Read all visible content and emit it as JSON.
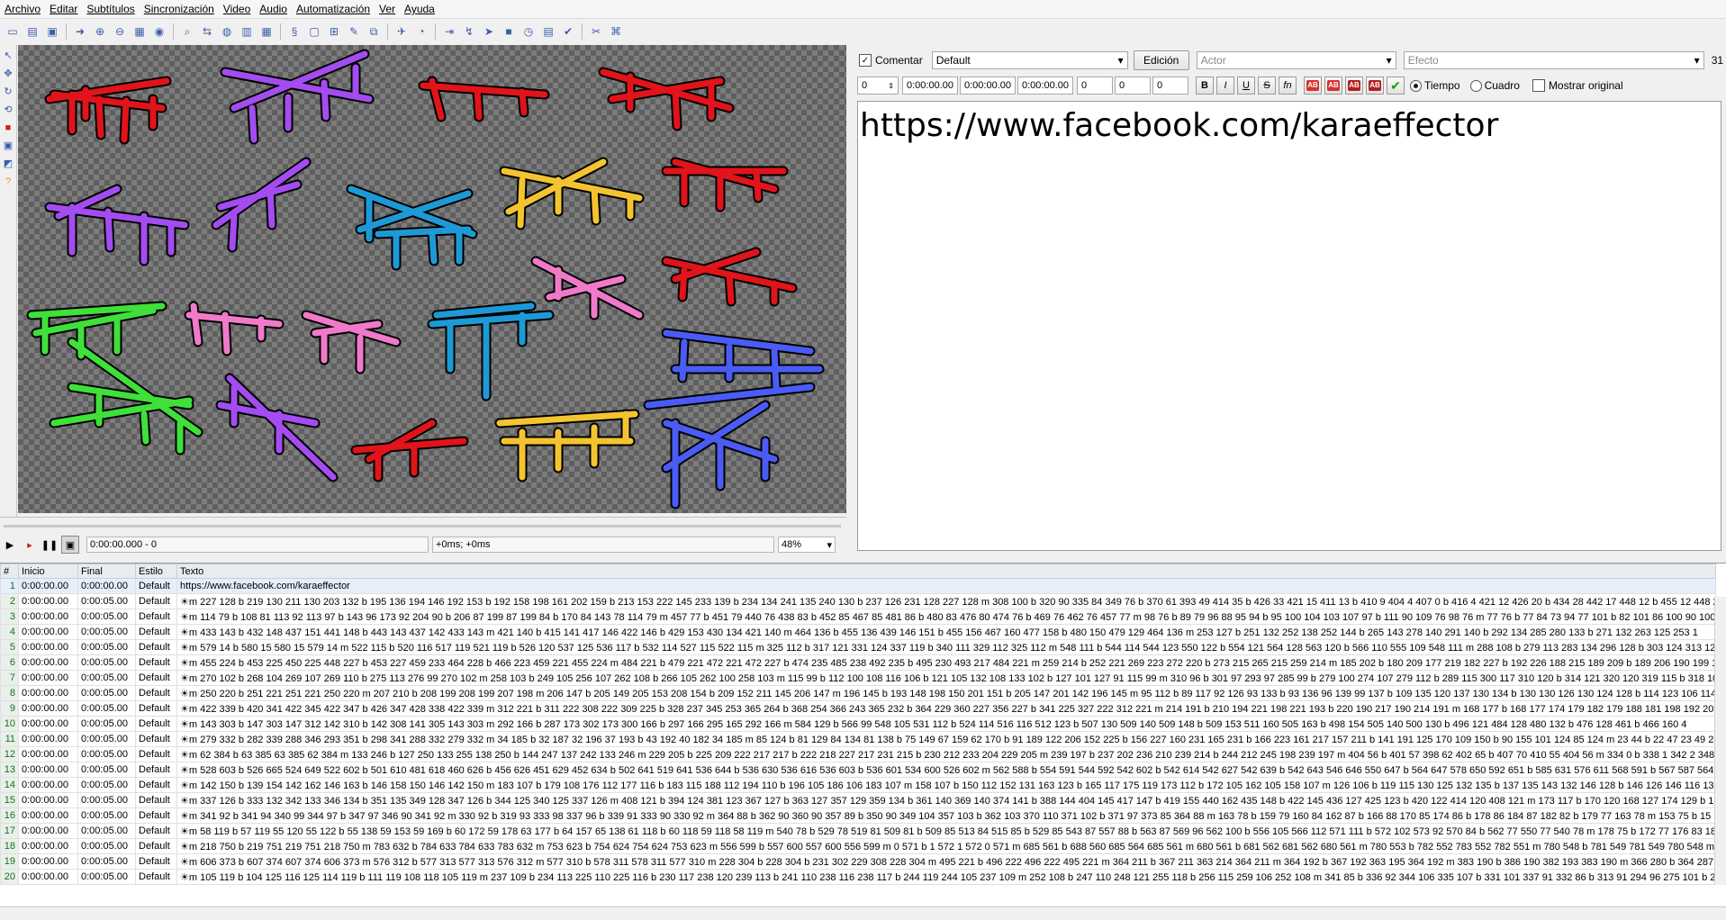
{
  "menu": [
    "Archivo",
    "Editar",
    "Subtítulos",
    "Sincronización",
    "Video",
    "Audio",
    "Automatización",
    "Ver",
    "Ayuda"
  ],
  "video": {
    "time_display": "0:00:00.000 - 0",
    "offset_display": "+0ms; +0ms",
    "zoom": "48%"
  },
  "editor": {
    "comment_label": "Comentar",
    "style_value": "Default",
    "edit_button": "Edición",
    "actor_placeholder": "Actor",
    "effect_placeholder": "Efecto",
    "char_count": "31",
    "layer": "0",
    "start_time": "0:00:00.00",
    "end_time": "0:00:00.00",
    "duration": "0:00:00.00",
    "margin_l": "0",
    "margin_r": "0",
    "margin_v": "0",
    "bold": "B",
    "italic": "I",
    "underline": "U",
    "strike": "S",
    "font": "fn",
    "color_label": "AB",
    "time_radio": "Tiempo",
    "frame_radio": "Cuadro",
    "show_original": "Mostrar original",
    "text": "https://www.facebook.com/karaeffector"
  },
  "grid": {
    "headers": [
      "#",
      "Inicio",
      "Final",
      "Estilo",
      "Texto"
    ],
    "rows": [
      {
        "n": "1",
        "start": "0:00:00.00",
        "end": "0:00:00.00",
        "style": "Default",
        "text": "https://www.facebook.com/karaeffector"
      },
      {
        "n": "2",
        "start": "0:00:00.00",
        "end": "0:00:05.00",
        "style": "Default",
        "text": "☀m 227 128 b 219 130 211 130 203 132 b 195 136 194 146 192 153 b 192 158 198 161 202 159 b 213 153 222 145 233 139 b 234 134 241 135 240 130 b 237 126 231 128 227 128 m 308 100 b 320 90 335 84 349 76 b 370 61 393 49 414 35 b 426 33 421 15 411 13 b 410 9 404 4 407 0 b 416 4 421 12 426 20 b 434 28 442 17 448 12 b 455 12 448 20 45"
      },
      {
        "n": "3",
        "start": "0:00:00.00",
        "end": "0:00:05.00",
        "style": "Default",
        "text": "☀m 114 79 b 108 81 113 92 113 97 b 143 96 173 92 204 90 b 206 87 199 87 199 84 b 170 84 143 78 114 79 m 457 77 b 451 79 440 76 438 83 b 452 85 467 85 481 86 b 480 83 476 80 474 76 b 469 76 462 76 457 77 m 98 76 b 89 79 96 88 95 94 b 95 100 104 103 107 97 b 111 90 109 76 98 76 m 77 76 b 77 84 73 94 77 101 b 82 101 86 100 90 100 b 90"
      },
      {
        "n": "4",
        "start": "0:00:00.00",
        "end": "0:00:05.00",
        "style": "Default",
        "text": "☀m 433 143 b 432 148 437 151 441 148 b 443 143 437 142 433 143 m 421 140 b 415 141 417 146 422 146 b 429 153 430 134 421 140 m 464 136 b 455 136 439 146 151 b 455 156 467 160 477 158 b 480 150 479 129 464 136 m 253 127 b 251 132 252 138 252 144 b 265 143 278 140 291 140 b 292 134 285 280 133 b 271 132 263 125 253 1"
      },
      {
        "n": "5",
        "start": "0:00:00.00",
        "end": "0:00:05.00",
        "style": "Default",
        "text": "☀m 579 14 b 580 15 580 15 579 14 m 522 115 b 520 116 517 119 521 119 b 526 120 537 125 536 117 b 532 114 527 115 522 115 m 325 112 b 317 121 331 124 337 119 b 340 111 329 112 325 112 m 548 111 b 544 114 544 123 550 122 b 554 121 564 128 563 120 b 566 110 555 109 548 111 m 288 108 b 279 113 283 134 296 128 b 303 124 313 126 3"
      },
      {
        "n": "6",
        "start": "0:00:00.00",
        "end": "0:00:05.00",
        "style": "Default",
        "text": "☀m 455 224 b 453 225 450 225 448 227 b 453 227 459 233 464 228 b 466 223 459 221 455 224 m 484 221 b 479 221 472 221 472 227 b 474 235 485 238 492 235 b 495 230 493 217 484 221 m 259 214 b 252 221 269 223 272 220 b 273 215 265 215 259 214 m 185 202 b 180 209 177 219 182 227 b 192 226 188 215 189 209 b 189 206 190 199 185 20"
      },
      {
        "n": "7",
        "start": "0:00:00.00",
        "end": "0:00:05.00",
        "style": "Default",
        "text": "☀m 270 102 b 268 104 269 107 269 110 b 275 113 276 99 270 102 m 258 103 b 249 105 256 107 262 108 b 266 105 262 100 258 103 m 115 99 b 112 100 108 116 106 b 121 105 132 108 133 102 b 127 101 127 91 115 99 m 310 96 b 301 97 293 97 285 99 b 279 100 274 107 279 112 b 289 115 300 117 310 120 b 314 121 320 120 319 115 b 318 10"
      },
      {
        "n": "8",
        "start": "0:00:00.00",
        "end": "0:00:05.00",
        "style": "Default",
        "text": "☀m 250 220 b 251 221 251 221 250 220 m 207 210 b 208 199 208 199 207 198 m 206 147 b 205 149 205 153 208 154 b 209 152 211 145 206 147 m 196 145 b 193 148 198 150 201 151 b 205 147 201 142 196 145 m 95 112 b 89 117 92 126 93 133 b 93 136 96 139 99 137 b 109 135 120 137 130 134 b 130 130 126 130 124 128 b 114 123 106 114 95 1"
      },
      {
        "n": "9",
        "start": "0:00:00.00",
        "end": "0:00:05.00",
        "style": "Default",
        "text": "☀m 422 339 b 420 341 422 345 422 347 b 426 347 428 338 422 339 m 312 221 b 311 222 308 222 309 225 b 328 237 345 253 365 264 b 368 254 366 243 365 232 b 364 229 360 227 356 227 b 341 225 327 222 312 221 m 214 191 b 210 194 221 198 221 193 b 220 190 217 190 214 191 m 168 177 b 168 177 174 179 182 179 188 181 198 192 207 19"
      },
      {
        "n": "10",
        "start": "0:00:00.00",
        "end": "0:00:05.00",
        "style": "Default",
        "text": "☀m 143 303 b 147 303 147 312 142 310 b 142 308 141 305 143 303 m 292 166 b 287 173 302 173 300 166 b 297 166 295 165 292 166 m 584 129 b 566 99 548 105 531 112 b 524 114 516 116 512 123 b 507 130 509 140 509 148 b 509 153 511 160 505 163 b 498 154 505 140 500 130 b 496 121 484 128 480 132 b 476 128 461 b 466 160 4"
      },
      {
        "n": "11",
        "start": "0:00:00.00",
        "end": "0:00:05.00",
        "style": "Default",
        "text": "☀m 279 332 b 282 339 288 346 293 351 b 298 341 288 332 279 332 m 34 185 b 32 187 32 196 37 193 b 43 192 40 182 34 185 m 85 124 b 81 129 84 134 81 138 b 75 149 67 159 62 170 b 91 189 122 206 152 225 b 156 227 160 231 165 231 b 166 223 161 217 157 211 b 141 191 125 170 109 150 b 90 155 101 124 85 124 m 23 44 b 22 47 23 49 23 5"
      },
      {
        "n": "12",
        "start": "0:00:00.00",
        "end": "0:00:05.00",
        "style": "Default",
        "text": "☀m 62 384 b 63 385 63 385 62 384 m 133 246 b 127 250 133 255 138 250 b 144 247 137 242 133 246 m 229 205 b 225 209 222 217 217 b 222 218 227 217 231 215 b 230 212 233 204 229 205 m 239 197 b 237 202 236 210 239 214 b 244 212 245 198 239 197 m 404 56 b 401 57 398 62 402 65 b 407 70 410 55 404 56 m 334 0 b 338 1 342 2 348 3"
      },
      {
        "n": "13",
        "start": "0:00:00.00",
        "end": "0:00:05.00",
        "style": "Default",
        "text": "☀m 528 603 b 526 665 524 649 522 602 b 501 610 481 618 460 626 b 456 626 451 629 452 634 b 502 641 519 641 536 644 b 536 630 536 616 536 603 b 536 601 534 600 526 602 m 562 588 b 554 591 544 592 542 602 b 542 614 542 627 542 639 b 542 643 546 646 550 647 b 564 647 578 650 592 651 b 585 631 576 611 568 591 b 567 587 564 587 5"
      },
      {
        "n": "14",
        "start": "0:00:00.00",
        "end": "0:00:05.00",
        "style": "Default",
        "text": "☀m 142 150 b 139 154 142 162 146 163 b 146 158 150 146 142 150 m 183 107 b 179 108 176 112 177 116 b 183 115 188 112 194 110 b 196 105 186 106 183 107 m 158 107 b 150 112 152 131 163 123 b 165 117 175 119 173 112 b 172 105 162 105 158 107 m 126 106 b 119 115 130 125 132 135 b 137 135 143 132 146 128 b 146 126 146 116 135 10"
      },
      {
        "n": "15",
        "start": "0:00:00.00",
        "end": "0:00:05.00",
        "style": "Default",
        "text": "☀m 337 126 b 333 132 342 133 346 134 b 351 135 349 128 347 126 b 344 125 340 125 337 126 m 408 121 b 394 124 381 123 367 127 b 363 127 357 129 359 134 b 361 140 369 140 374 141 b 388 144 404 145 417 147 b 419 155 440 162 435 148 b 422 145 436 127 425 123 b 420 122 414 120 408 121 m 173 117 b 170 120 168 127 174 129 b 182 13"
      },
      {
        "n": "16",
        "start": "0:00:00.00",
        "end": "0:00:05.00",
        "style": "Default",
        "text": "☀m 341 92 b 341 94 340 99 344 97 b 347 97 346 90 341 92 m 330 92 b 319 93 333 98 337 96 b 339 91 333 90 330 92 m 364 88 b 362 90 360 90 357 89 b 350 90 349 104 357 103 b 362 103 370 110 371 102 b 371 97 373 85 364 88 m 163 78 b 159 79 160 84 162 87 b 166 88 170 85 174 86 b 178 86 184 87 182 82 b 179 77 163 78 m 153 75 b 15"
      },
      {
        "n": "17",
        "start": "0:00:00.00",
        "end": "0:00:05.00",
        "style": "Default",
        "text": "☀m 58 119 b 57 119 55 120 55 122 b 55 138 59 153 59 169 b 60 172 59 178 63 177 b 64 157 65 138 61 118 b 60 118 59 118 58 119 m 540 78 b 529 78 519 81 509 81 b 509 85 513 84 515 85 b 529 85 543 87 557 88 b 563 87 569 96 562 100 b 556 105 566 112 571 111 b 572 102 573 92 570 84 b 562 77 550 77 540 78 m 178 75 b 172 77 176 83 181 8"
      },
      {
        "n": "18",
        "start": "0:00:00.00",
        "end": "0:00:05.00",
        "style": "Default",
        "text": "☀m 218 750 b 219 751 219 751 218 750 m 783 632 b 784 633 784 633 783 632 m 753 623 b 754 624 754 624 753 623 m 556 599 b 557 600 557 600 556 599 m 0 571 b 1 572 1 572 0 571 m 685 561 b 688 560 685 564 685 561 m 680 561 b 681 562 681 562 680 561 m 780 553 b 782 552 783 552 782 551 m 780 548 b 781 549 781 549 780 548 m 652 46"
      },
      {
        "n": "19",
        "start": "0:00:00.00",
        "end": "0:00:05.00",
        "style": "Default",
        "text": "☀m 606 373 b 607 374 607 374 606 373 m 576 312 b 577 313 577 313 576 312 m 577 310 b 578 311 578 311 577 310 m 228 304 b 228 304 b 231 302 229 308 228 304 m 495 221 b 496 222 496 222 495 221 m 364 211 b 367 211 363 214 364 211 m 364 192 b 367 192 363 195 364 192 m 383 190 b 386 190 382 193 383 190 m 366 280 b 364 287 377 287 376 281"
      },
      {
        "n": "20",
        "start": "0:00:00.00",
        "end": "0:00:05.00",
        "style": "Default",
        "text": "☀m 105 119 b 104 125 116 125 114 119 b 111 119 108 118 105 119 m 237 109 b 234 113 225 110 225 116 b 230 117 238 120 239 113 b 241 110 238 116 238 117 b 244 119 244 105 237 109 m 252 108 b 247 110 248 121 255 118 b 256 115 259 106 252 108 m 341 85 b 336 92 344 106 335 107 b 331 101 337 91 332 86 b 313 91 294 96 275 101 b 265 1"
      }
    ]
  }
}
